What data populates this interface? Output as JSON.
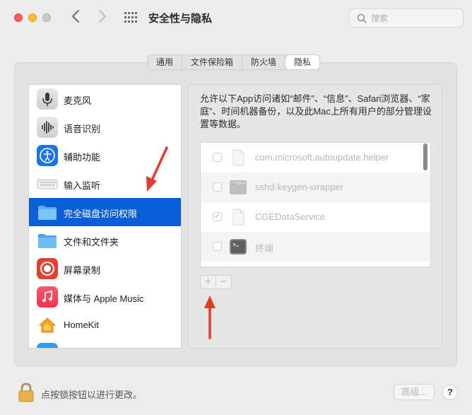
{
  "window": {
    "title": "安全性与隐私",
    "search_placeholder": "搜索"
  },
  "tabs": [
    {
      "label": "通用"
    },
    {
      "label": "文件保险箱"
    },
    {
      "label": "防火墙"
    },
    {
      "label": "隐私",
      "active": true
    }
  ],
  "sidebar": {
    "items": [
      {
        "label": "麦克风",
        "icon": "microphone-icon"
      },
      {
        "label": "语音识别",
        "icon": "waveform-icon"
      },
      {
        "label": "辅助功能",
        "icon": "accessibility-icon"
      },
      {
        "label": "输入监听",
        "icon": "keyboard-icon"
      },
      {
        "label": "完全磁盘访问权限",
        "icon": "folder-icon",
        "selected": true
      },
      {
        "label": "文件和文件夹",
        "icon": "folder-icon"
      },
      {
        "label": "屏幕录制",
        "icon": "screen-record-icon"
      },
      {
        "label": "媒体与 Apple Music",
        "icon": "music-icon"
      },
      {
        "label": "HomeKit",
        "icon": "home-icon"
      }
    ]
  },
  "main": {
    "description": "允许以下App访问诸如“邮件”、“信息”、Safari浏览器、“家庭”、时间机器备份，以及此Mac上所有用户的部分管理设置等数据。",
    "apps": [
      {
        "name": "com.microsoft.autoupdate.helper",
        "checked": false,
        "icon": "document-icon"
      },
      {
        "name": "sshd-keygen-wrapper",
        "checked": false,
        "icon": "executable-icon"
      },
      {
        "name": "CGEDataService",
        "checked": true,
        "icon": "document-icon"
      },
      {
        "name": "终端",
        "checked": false,
        "icon": "terminal-icon"
      }
    ],
    "add_label": "+",
    "remove_label": "−"
  },
  "footer": {
    "lock_text": "点按锁按钮以进行更改。",
    "advanced_label": "高级...",
    "help_label": "?"
  },
  "colors": {
    "selection": "#0a5ed8",
    "arrow": "#e8392c",
    "close": "#fe5f57",
    "minimize": "#febc2e"
  }
}
